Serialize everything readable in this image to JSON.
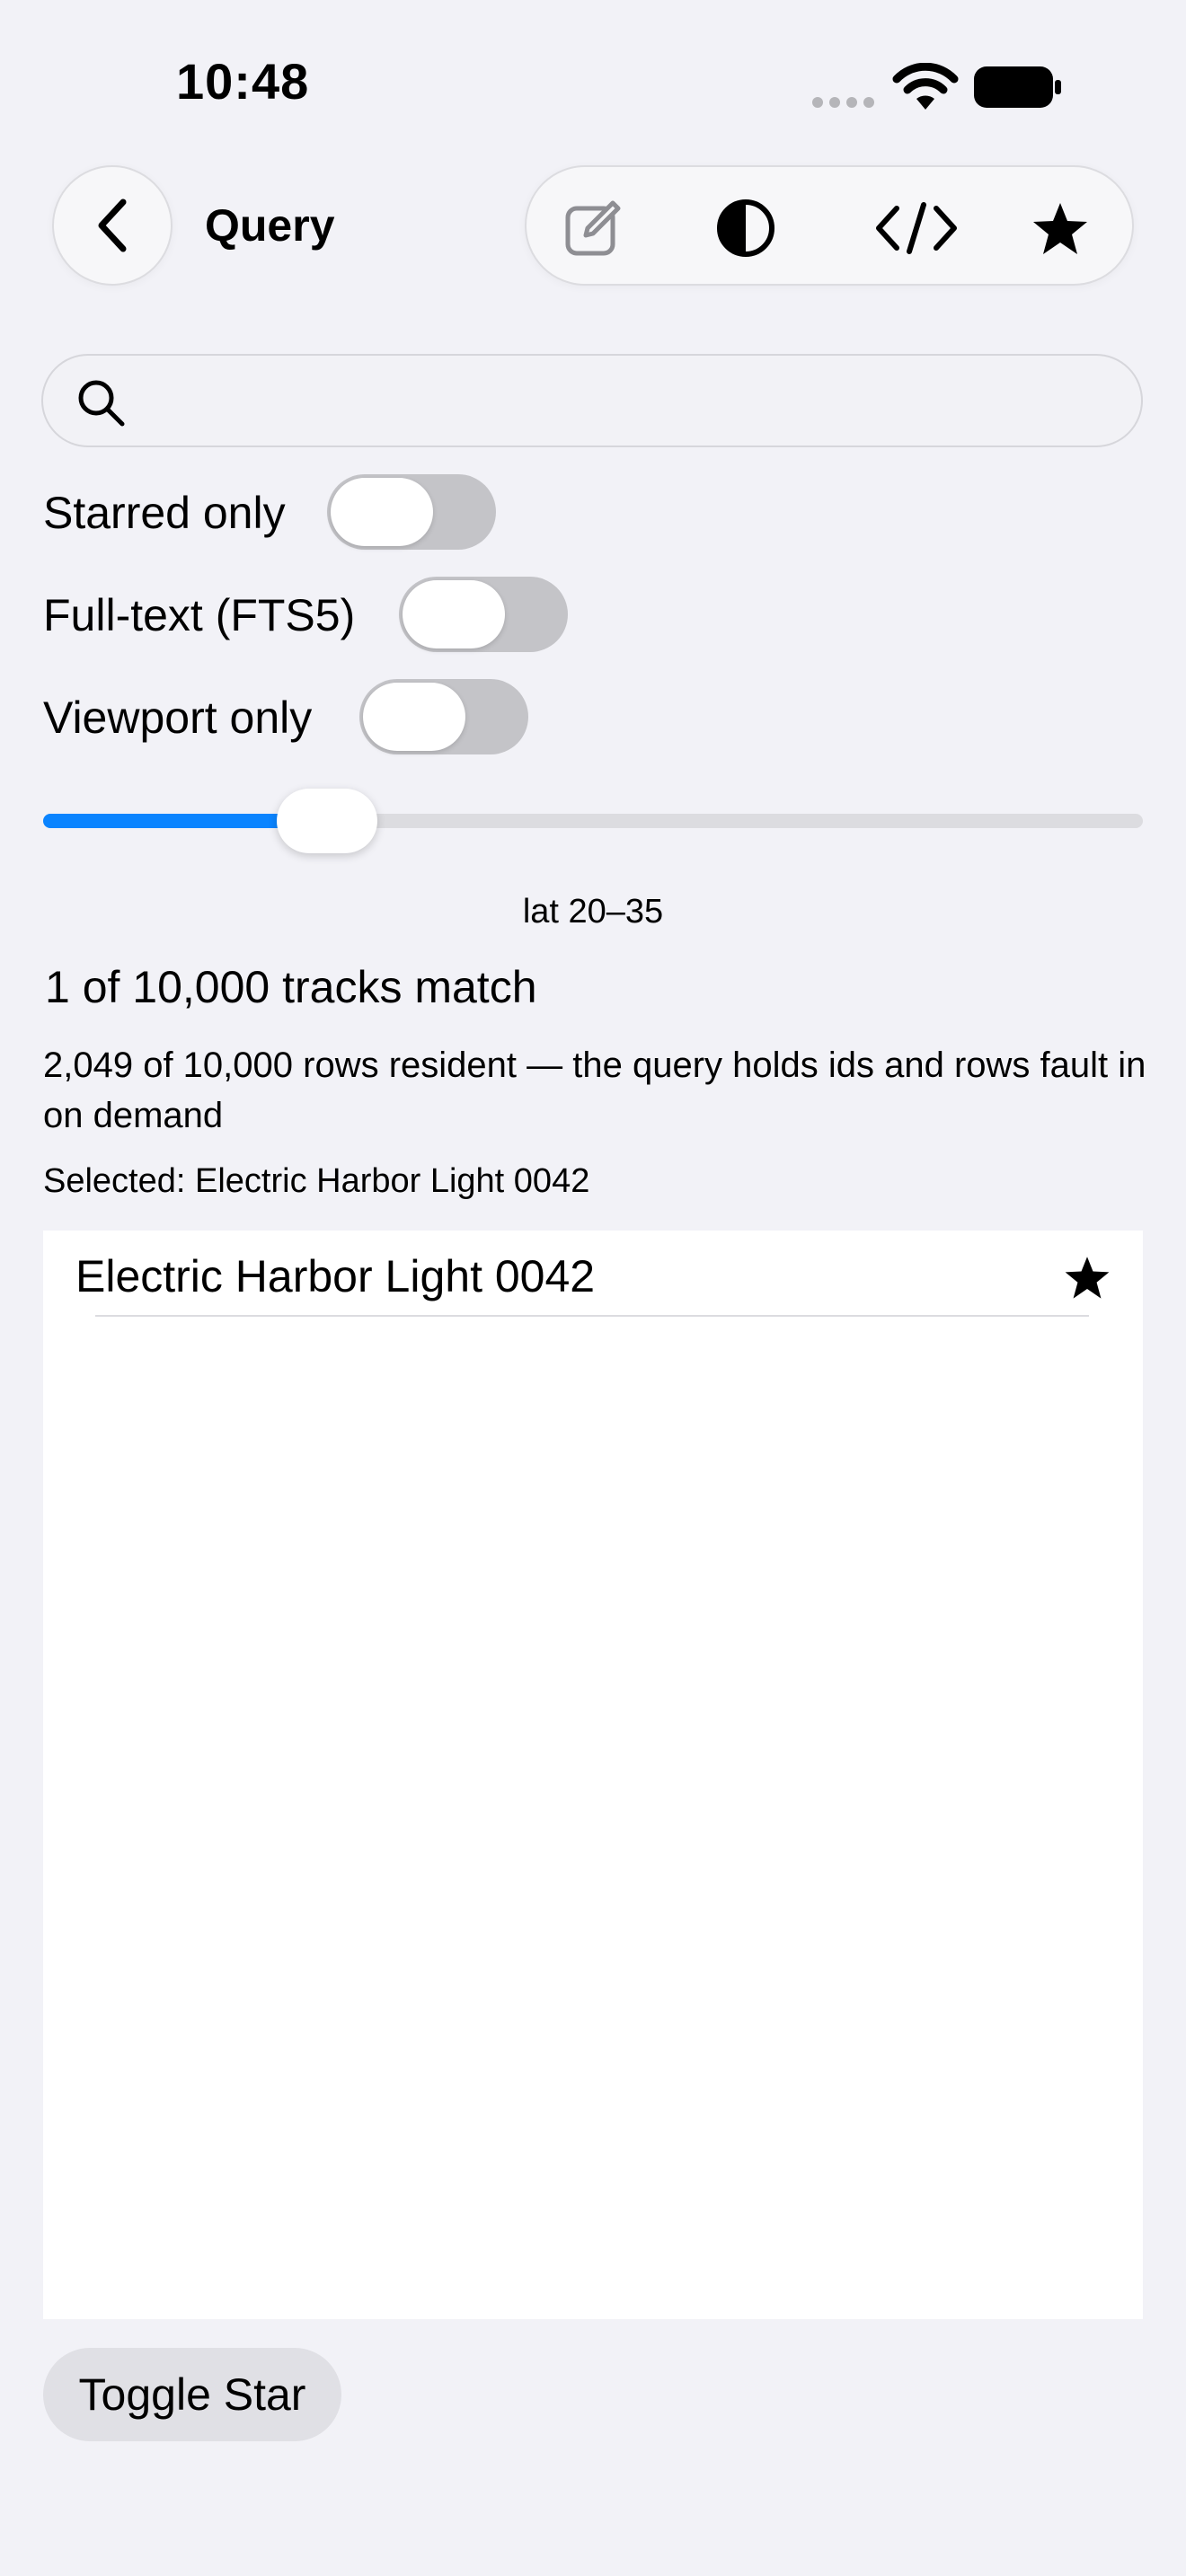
{
  "status_bar": {
    "time": "10:48"
  },
  "nav": {
    "title": "Query"
  },
  "toolbar": {
    "icons": [
      "compose-icon",
      "contrast-icon",
      "code-icon",
      "star-icon"
    ]
  },
  "search": {
    "placeholder": "",
    "value": ""
  },
  "filters": [
    {
      "label": "Starred only",
      "on": false
    },
    {
      "label": "Full-text (FTS5)",
      "on": false
    },
    {
      "label": "Viewport only",
      "on": false
    }
  ],
  "slider": {
    "label": "lat 20–35",
    "fraction": 0.25,
    "accent": "#0a84ff"
  },
  "results": {
    "match_summary": "1 of 10,000 tracks match",
    "resident_note": "2,049 of 10,000 rows resident — the query holds ids and rows fault in on demand",
    "selected": "Selected: Electric Harbor Light 0042"
  },
  "list": {
    "rows": [
      {
        "title": "Electric Harbor Light 0042",
        "starred": true
      }
    ]
  },
  "actions": {
    "toggle_star": "Toggle Star"
  }
}
